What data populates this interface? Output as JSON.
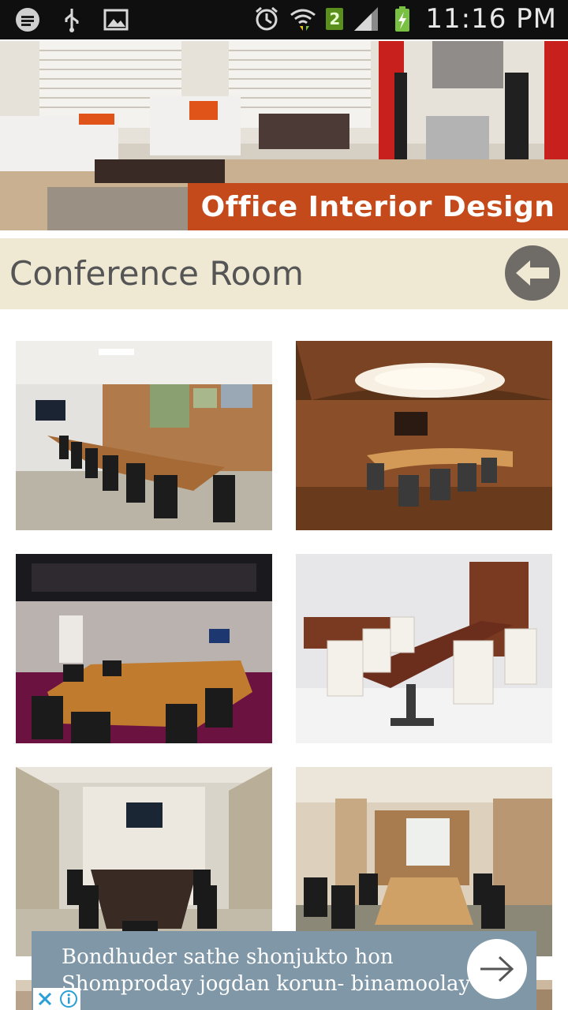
{
  "status_bar": {
    "time": "11:16 PM",
    "sim_badge": "2",
    "icons": [
      "chat-icon",
      "usb-icon",
      "image-icon",
      "alarm-icon",
      "wifi-icon",
      "signal-icon",
      "battery-charging-icon"
    ]
  },
  "banner": {
    "label": "Office Interior Design"
  },
  "header": {
    "title": "Conference Room",
    "back_icon": "back-arrow-icon"
  },
  "gallery": {
    "count": 8
  },
  "ad": {
    "line1": "Bondhuder sathe shonjukto hon",
    "line2": "Shomproday jogdan korun- binamoolay",
    "arrow_icon": "arrow-right-icon"
  },
  "colors": {
    "title_bar_bg": "#efe9d4",
    "banner_label_bg": "#c44a1c",
    "ad_bg": "#7f97a7"
  }
}
